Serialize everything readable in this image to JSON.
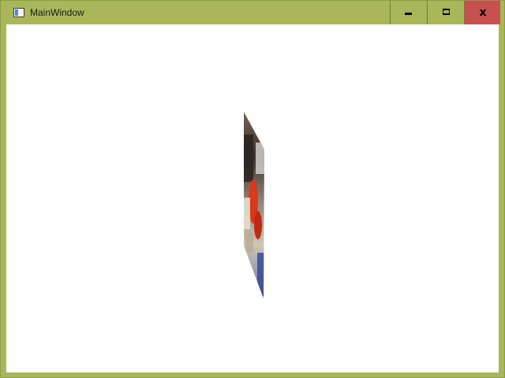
{
  "window": {
    "title": "MainWindow",
    "icon": "app-window-icon",
    "frame_color": "#a9b75a",
    "close_color": "#c75050",
    "controls": {
      "minimize_icon": "minimize-icon",
      "maximize_icon": "maximize-icon",
      "close_glyph": "x"
    }
  },
  "content": {
    "background": "#ffffff",
    "image": {
      "description_icon": "perspective-photo",
      "colors": [
        "#6b5a4a",
        "#2a2320",
        "#d8d0c0",
        "#d83a1c",
        "#3a4a9a"
      ]
    }
  }
}
